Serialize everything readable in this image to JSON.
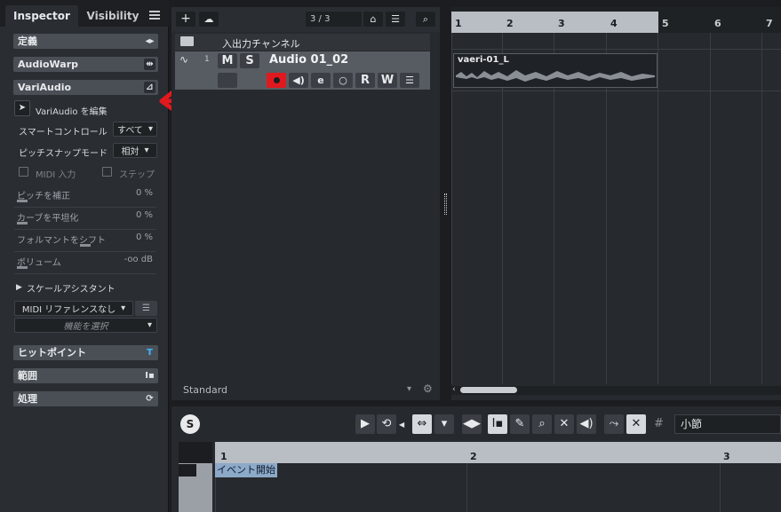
{
  "inspector": {
    "tabs": [
      {
        "label": "Inspector"
      },
      {
        "label": "Visibility"
      }
    ],
    "sections": {
      "definition": "定義",
      "audiowarp": "AudioWarp",
      "variaudio": "VariAudio",
      "hitpoints": "ヒットポイント",
      "range": "範囲",
      "process": "処理"
    },
    "variaudio_panel": {
      "edit_label": "VariAudio を編集",
      "smart_control_label": "スマートコントロール",
      "smart_control_value": "すべて",
      "pitch_snap_label": "ピッチスナップモード",
      "pitch_snap_value": "相対",
      "midi_input_label": "MIDI 入力",
      "step_label": "ステップ",
      "sliders": [
        {
          "name": "ピッチを補正",
          "value": "0 %"
        },
        {
          "name": "カーブを平坦化",
          "value": "0 %"
        },
        {
          "name": "フォルマントをシフト",
          "value": "0 %"
        },
        {
          "name": "ボリューム",
          "value": "-oo dB"
        }
      ],
      "scale_assistant_label": "スケールアシスタント",
      "midi_reference_value": "MIDI リファレンスなし",
      "function_select_placeholder": "機能を選択"
    }
  },
  "tracklist": {
    "track_counter": "3 / 3",
    "folder_track_name": "入出力チャンネル",
    "audio_track": {
      "number": "1",
      "name": "Audio 01_02",
      "mute_label": "M",
      "solo_label": "S",
      "read_label": "R",
      "write_label": "W"
    },
    "footer_label": "Standard"
  },
  "arrange": {
    "ruler_bars": [
      "1",
      "2",
      "3",
      "4",
      "5",
      "6",
      "7"
    ],
    "event_name": "vaeri-01_L"
  },
  "lower_editor": {
    "solo_label": "S",
    "unit_value": "小節",
    "ruler_bars": [
      "1",
      "2",
      "3"
    ],
    "event_start_label": "イベント開始"
  },
  "colors": {
    "annotation_arrow": "#e0191f",
    "record_button": "#e0191f",
    "accent_hitpoint": "#3fb8ff"
  }
}
